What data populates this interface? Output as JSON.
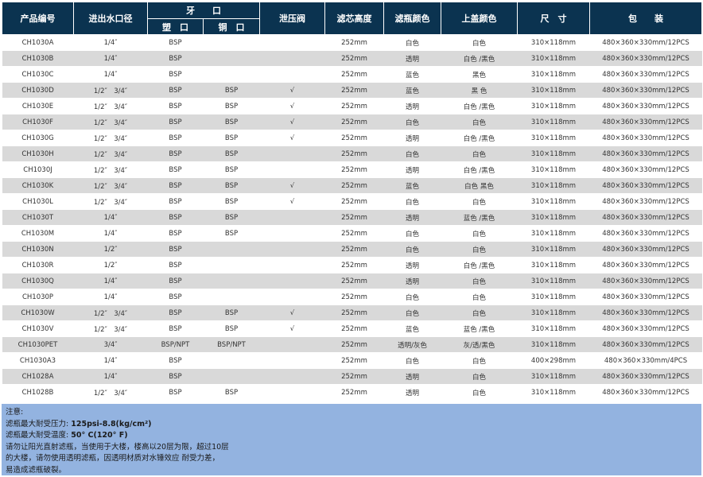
{
  "header": {
    "code": "产品编号",
    "inlet": "进出水口径",
    "thread": "牙　　口",
    "thread_plastic": "塑　口",
    "thread_copper": "铜　口",
    "relief_valve": "泄压阀",
    "core_height": "滤芯高度",
    "bottle_color": "滤瓶颜色",
    "cap_color": "上盖颜色",
    "size": "尺　寸",
    "packing": "包　　装"
  },
  "rows": [
    {
      "code": "CH1030A",
      "inlet": "1/4″",
      "plastic": "BSP",
      "copper": "",
      "valve": "",
      "height": "252mm",
      "bottle": "白色",
      "cap": "白色",
      "size": "310×118mm",
      "pack": "480×360×330mm/12PCS"
    },
    {
      "code": "CH1030B",
      "inlet": "1/4″",
      "plastic": "BSP",
      "copper": "",
      "valve": "",
      "height": "252mm",
      "bottle": "透明",
      "cap": "白色 /黑色",
      "size": "310×118mm",
      "pack": "480×360×330mm/12PCS"
    },
    {
      "code": "CH1030C",
      "inlet": "1/4″",
      "plastic": "BSP",
      "copper": "",
      "valve": "",
      "height": "252mm",
      "bottle": "蓝色",
      "cap": "黑色",
      "size": "310×118mm",
      "pack": "480×360×330mm/12PCS"
    },
    {
      "code": "CH1030D",
      "inlet": "1/2″　3/4″",
      "plastic": "BSP",
      "copper": "BSP",
      "valve": "√",
      "height": "252mm",
      "bottle": "蓝色",
      "cap": "黑 色",
      "size": "310×118mm",
      "pack": "480×360×330mm/12PCS"
    },
    {
      "code": "CH1030E",
      "inlet": "1/2″　3/4″",
      "plastic": "BSP",
      "copper": "BSP",
      "valve": "√",
      "height": "252mm",
      "bottle": "透明",
      "cap": "白色 /黑色",
      "size": "310×118mm",
      "pack": "480×360×330mm/12PCS"
    },
    {
      "code": "CH1030F",
      "inlet": "1/2″　3/4″",
      "plastic": "BSP",
      "copper": "BSP",
      "valve": "√",
      "height": "252mm",
      "bottle": "白色",
      "cap": "白色",
      "size": "310×118mm",
      "pack": "480×360×330mm/12PCS"
    },
    {
      "code": "CH1030G",
      "inlet": "1/2″　3/4″",
      "plastic": "BSP",
      "copper": "BSP",
      "valve": "√",
      "height": "252mm",
      "bottle": "透明",
      "cap": "白色 /黑色",
      "size": "310×118mm",
      "pack": "480×360×330mm/12PCS"
    },
    {
      "code": "CH1030H",
      "inlet": "1/2″　3/4″",
      "plastic": "BSP",
      "copper": "BSP",
      "valve": "",
      "height": "252mm",
      "bottle": "白色",
      "cap": "白色",
      "size": "310×118mm",
      "pack": "480×360×330mm/12PCS"
    },
    {
      "code": "CH1030J",
      "inlet": "1/2″　3/4″",
      "plastic": "BSP",
      "copper": "BSP",
      "valve": "",
      "height": "252mm",
      "bottle": "透明",
      "cap": "白色 /黑色",
      "size": "310×118mm",
      "pack": "480×360×330mm/12PCS"
    },
    {
      "code": "CH1030K",
      "inlet": "1/2″　3/4″",
      "plastic": "BSP",
      "copper": "BSP",
      "valve": "√",
      "height": "252mm",
      "bottle": "蓝色",
      "cap": "白色 黑色",
      "size": "310×118mm",
      "pack": "480×360×330mm/12PCS"
    },
    {
      "code": "CH1030L",
      "inlet": "1/2″　3/4″",
      "plastic": "BSP",
      "copper": "BSP",
      "valve": "√",
      "height": "252mm",
      "bottle": "白色",
      "cap": "白色",
      "size": "310×118mm",
      "pack": "480×360×330mm/12PCS"
    },
    {
      "code": "CH1030T",
      "inlet": "1/4″",
      "plastic": "BSP",
      "copper": "BSP",
      "valve": "",
      "height": "252mm",
      "bottle": "透明",
      "cap": "蓝色 /黑色",
      "size": "310×118mm",
      "pack": "480×360×330mm/12PCS"
    },
    {
      "code": "CH1030M",
      "inlet": "1/4″",
      "plastic": "BSP",
      "copper": "BSP",
      "valve": "",
      "height": "252mm",
      "bottle": "白色",
      "cap": "白色",
      "size": "310×118mm",
      "pack": "480×360×330mm/12PCS"
    },
    {
      "code": "CH1030N",
      "inlet": "1/2″",
      "plastic": "BSP",
      "copper": "",
      "valve": "",
      "height": "252mm",
      "bottle": "白色",
      "cap": "白色",
      "size": "310×118mm",
      "pack": "480×360×330mm/12PCS"
    },
    {
      "code": "CH1030R",
      "inlet": "1/2″",
      "plastic": "BSP",
      "copper": "",
      "valve": "",
      "height": "252mm",
      "bottle": "透明",
      "cap": "白色 /黑色",
      "size": "310×118mm",
      "pack": "480×360×330mm/12PCS"
    },
    {
      "code": "CH1030Q",
      "inlet": "1/4″",
      "plastic": "BSP",
      "copper": "",
      "valve": "",
      "height": "252mm",
      "bottle": "透明",
      "cap": "白色",
      "size": "310×118mm",
      "pack": "480×360×330mm/12PCS"
    },
    {
      "code": "CH1030P",
      "inlet": "1/4″",
      "plastic": "BSP",
      "copper": "",
      "valve": "",
      "height": "252mm",
      "bottle": "白色",
      "cap": "白色",
      "size": "310×118mm",
      "pack": "480×360×330mm/12PCS"
    },
    {
      "code": "CH1030W",
      "inlet": "1/2″　3/4″",
      "plastic": "BSP",
      "copper": "BSP",
      "valve": "√",
      "height": "252mm",
      "bottle": "白色",
      "cap": "白色",
      "size": "310×118mm",
      "pack": "480×360×330mm/12PCS"
    },
    {
      "code": "CH1030V",
      "inlet": "1/2″　3/4″",
      "plastic": "BSP",
      "copper": "BSP",
      "valve": "√",
      "height": "252mm",
      "bottle": "蓝色",
      "cap": "蓝色 /黑色",
      "size": "310×118mm",
      "pack": "480×360×330mm/12PCS"
    },
    {
      "code": "CH1030PET",
      "inlet": "3/4″",
      "plastic": "BSP/NPT",
      "copper": "BSP/NPT",
      "valve": "",
      "height": "252mm",
      "bottle": "透明/灰色",
      "cap": "灰/透/黑色",
      "size": "310×118mm",
      "pack": "480×360×330mm/12PCS"
    },
    {
      "code": "CH1030A3",
      "inlet": "1/4″",
      "plastic": "BSP",
      "copper": "",
      "valve": "",
      "height": "252mm",
      "bottle": "白色",
      "cap": "白色",
      "size": "400×298mm",
      "pack": "480×360×330mm/4PCS"
    },
    {
      "code": "CH1028A",
      "inlet": "1/4″",
      "plastic": "BSP",
      "copper": "",
      "valve": "",
      "height": "252mm",
      "bottle": "透明",
      "cap": "白色",
      "size": "310×118mm",
      "pack": "480×360×330mm/12PCS"
    },
    {
      "code": "CH1028B",
      "inlet": "1/2″　3/4″",
      "plastic": "BSP",
      "copper": "BSP",
      "valve": "",
      "height": "252mm",
      "bottle": "透明",
      "cap": "白色",
      "size": "310×118mm",
      "pack": "480×360×330mm/12PCS"
    }
  ],
  "notes": {
    "title": "注意:",
    "pressure_label": "滤瓶最大耐受压力: ",
    "pressure_value": "125psi-8.8(kg/cm²)",
    "temp_label": "滤瓶最大耐受温度: ",
    "temp_value": "50° C(120° F)",
    "warning_1": "请勿让阳光直射滤瓶，当使用于大楼，楼高以20层为限，超过10层",
    "warning_2": "的大楼，请勿使用透明滤瓶，因透明材质对水锤效应 耐受力差，",
    "warning_3": "易造成滤瓶破裂。"
  },
  "colors": {
    "header_bg": "#0b3350",
    "row_alt_bg": "#d9d9d9",
    "notes_bg": "#93b3e0"
  }
}
